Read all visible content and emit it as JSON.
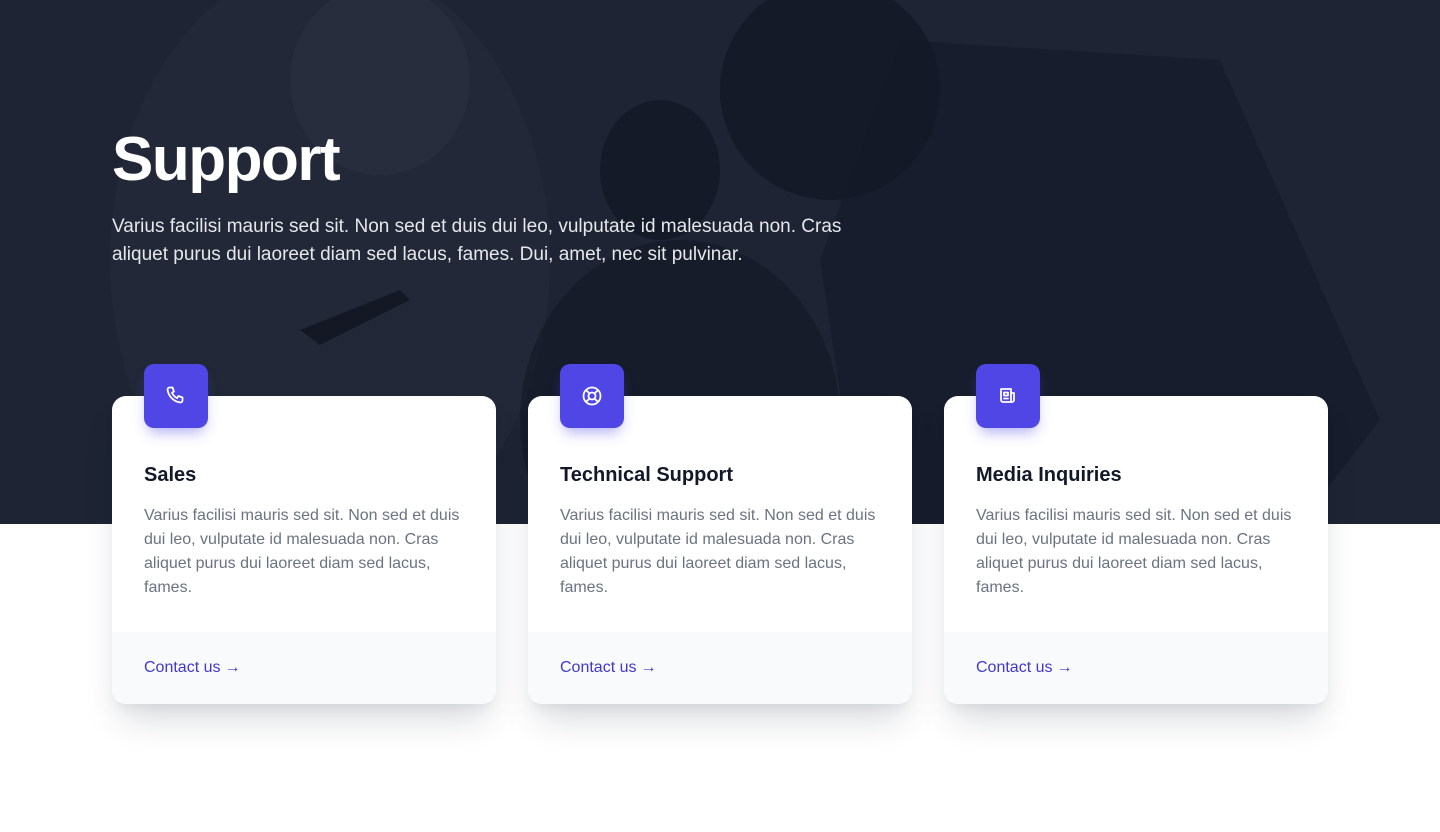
{
  "hero": {
    "title": "Support",
    "description": "Varius facilisi mauris sed sit. Non sed et duis dui leo, vulputate id malesuada non. Cras aliquet purus dui laoreet diam sed lacus, fames. Dui, amet, nec sit pulvinar."
  },
  "cards": [
    {
      "icon": "phone-icon",
      "title": "Sales",
      "text": "Varius facilisi mauris sed sit. Non sed et duis dui leo, vulputate id malesuada non. Cras aliquet purus dui laoreet diam sed lacus, fames.",
      "link_label": "Contact us",
      "link_arrow": "→"
    },
    {
      "icon": "lifebuoy-icon",
      "title": "Technical Support",
      "text": "Varius facilisi mauris sed sit. Non sed et duis dui leo, vulputate id malesuada non. Cras aliquet purus dui laoreet diam sed lacus, fames.",
      "link_label": "Contact us",
      "link_arrow": "→"
    },
    {
      "icon": "newspaper-icon",
      "title": "Media Inquiries",
      "text": "Varius facilisi mauris sed sit. Non sed et duis dui leo, vulputate id malesuada non. Cras aliquet purus dui laoreet diam sed lacus, fames.",
      "link_label": "Contact us",
      "link_arrow": "→"
    }
  ],
  "colors": {
    "accent": "#4f46e5",
    "link": "#4338ca",
    "hero_overlay": "#1e2434"
  }
}
